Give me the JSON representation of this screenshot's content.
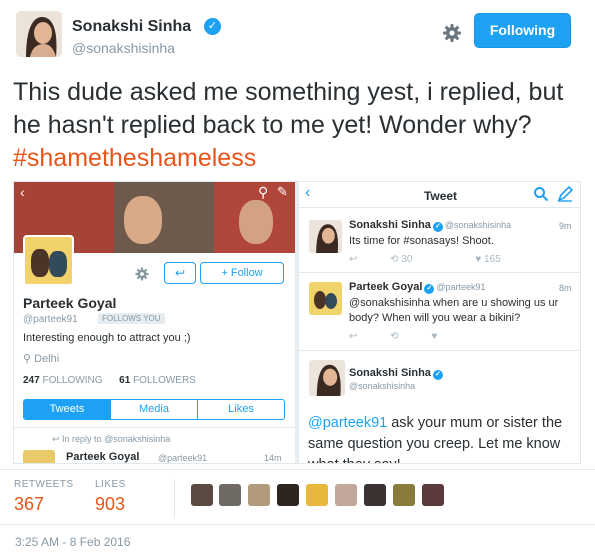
{
  "author": {
    "name": "Sonakshi Sinha",
    "handle": "@sonakshisinha",
    "verified_glyph": "✓",
    "follow_label": "Following"
  },
  "tweet": {
    "text": "This dude asked me something yest, i replied, but he hasn't replied back to me yet! Wonder why?",
    "hashtag": "#shametheshameless"
  },
  "screenshot": {
    "profile": {
      "name": "Parteek Goyal",
      "handle": "@parteek91",
      "follows_badge": "FOLLOWS YOU",
      "bio": "Interesting enough to attract you ;)",
      "location": "Delhi",
      "following_count": "247",
      "following_label": "FOLLOWING",
      "followers_count": "61",
      "followers_label": "FOLLOWERS",
      "follow_button": "Follow",
      "tabs": [
        "Tweets",
        "Media",
        "Likes"
      ],
      "in_reply": "In reply to @sonakshisinha",
      "mini_name": "Parteek Goyal",
      "mini_handle": "@parteek91",
      "mini_time": "14m"
    },
    "thread": {
      "title": "Tweet",
      "tweets": [
        {
          "name": "Sonakshi Sinha",
          "handle": "@sonakshisinha",
          "time": "9m",
          "text": "Its time for #sonasays! Shoot.",
          "retweets": "30",
          "likes": "165"
        },
        {
          "name": "Parteek Goyal",
          "handle": "@parteek91",
          "time": "8m",
          "text": "@sonakshisinha when are u showing us ur body? When will you wear a bikini?"
        }
      ],
      "reply": {
        "name": "Sonakshi Sinha",
        "handle": "@sonakshisinha",
        "mention": "@parteek91",
        "text": " ask your mum or sister the same question you creep. Let me know what they say!"
      }
    }
  },
  "stats": {
    "retweets_label": "RETWEETS",
    "retweets": "367",
    "likes_label": "LIKES",
    "likes": "903"
  },
  "timestamp": "3:25 AM - 8 Feb 2016",
  "colors": {
    "accent": "#1da1f2",
    "hashtag": "#e8541a",
    "muted": "#8899a6"
  },
  "icons": {
    "settings": "gear-icon",
    "verified": "verified-badge-icon",
    "reply": "reply-icon",
    "retweet": "retweet-icon",
    "like": "heart-icon",
    "search": "search-icon",
    "compose": "compose-icon",
    "location": "location-pin-icon"
  }
}
